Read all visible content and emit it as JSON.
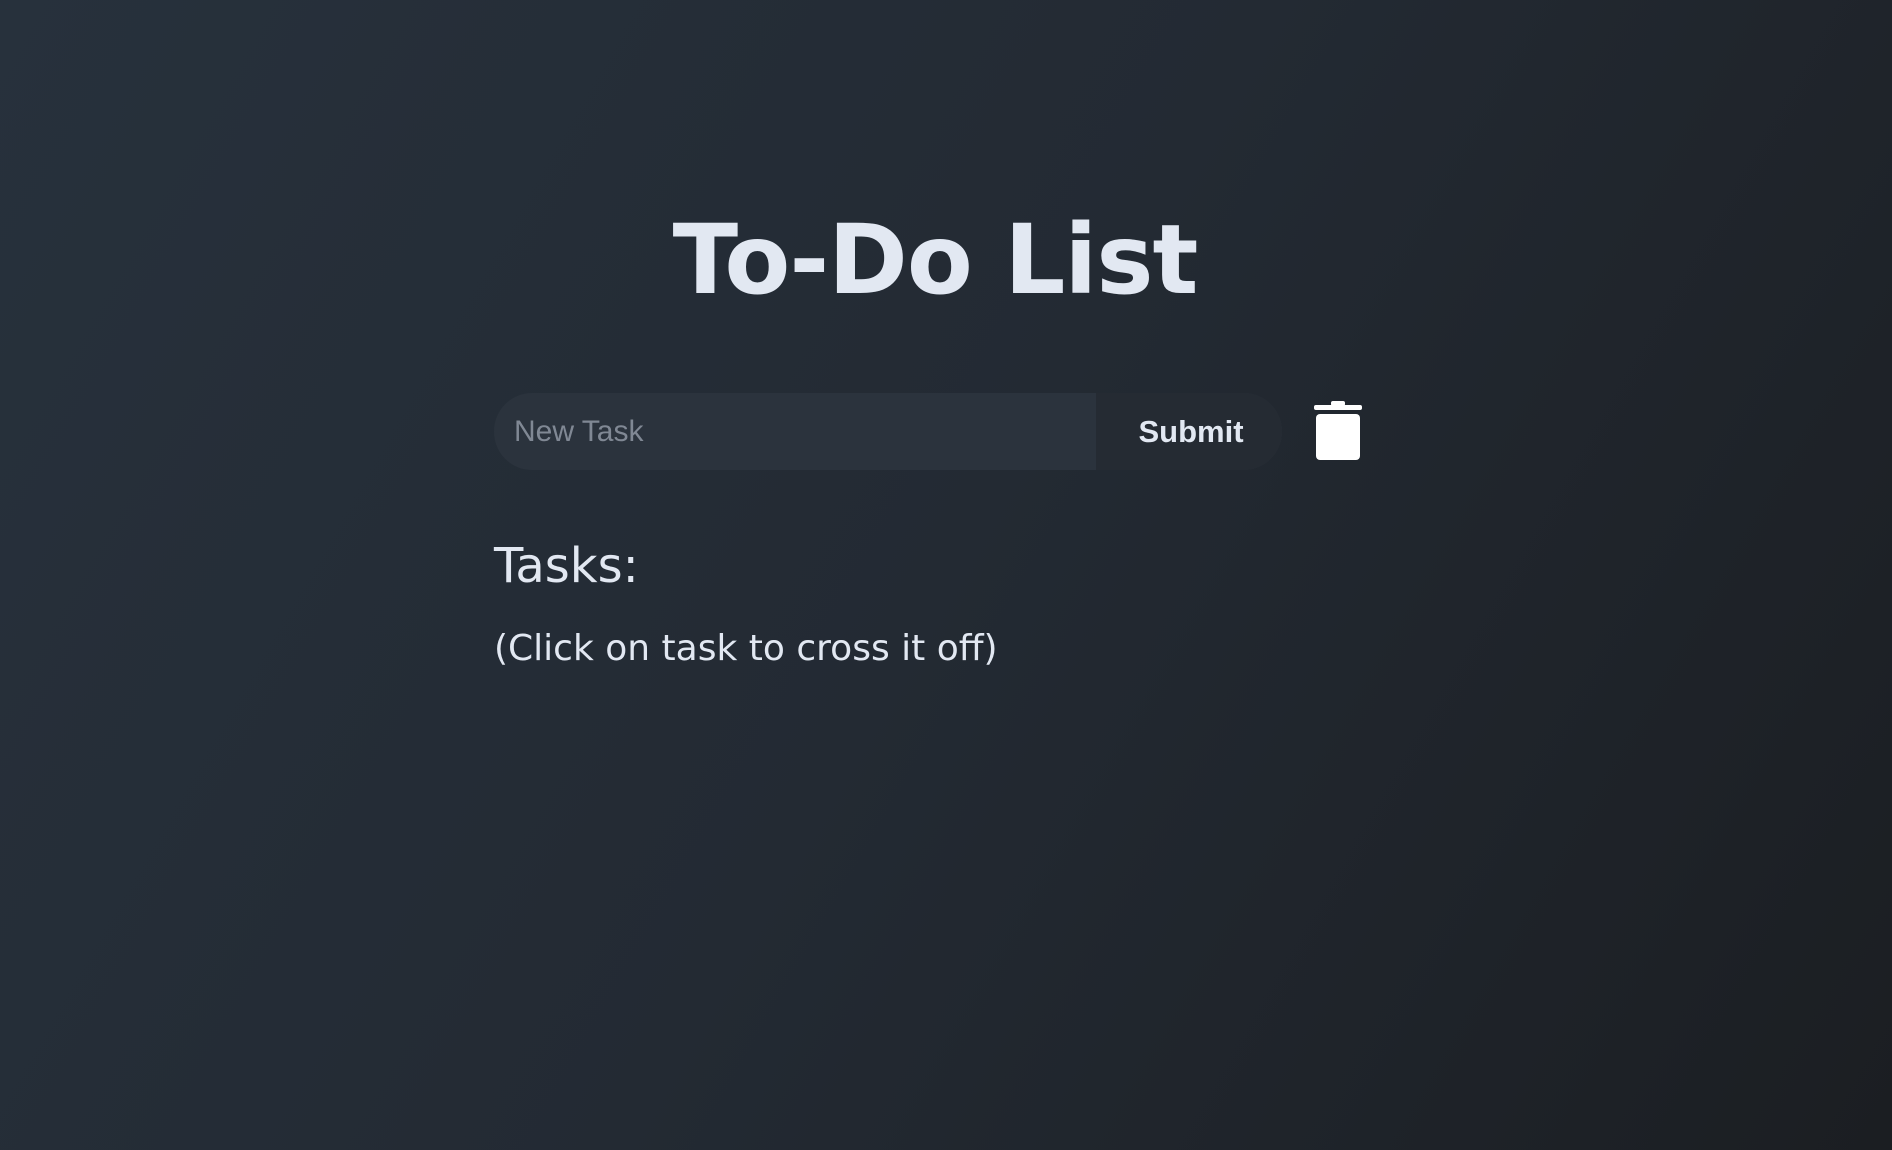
{
  "header": {
    "title": "To-Do List"
  },
  "form": {
    "input_placeholder": "New Task",
    "input_value": "",
    "submit_label": "Submit",
    "clear_icon": "trash-icon"
  },
  "tasks": {
    "heading": "Tasks:",
    "hint": "(Click on task to cross it off)",
    "items": []
  },
  "colors": {
    "text": "#e2e8f2",
    "input_background": "#2b333d",
    "button_background": "#252b33",
    "placeholder": "#808894"
  }
}
